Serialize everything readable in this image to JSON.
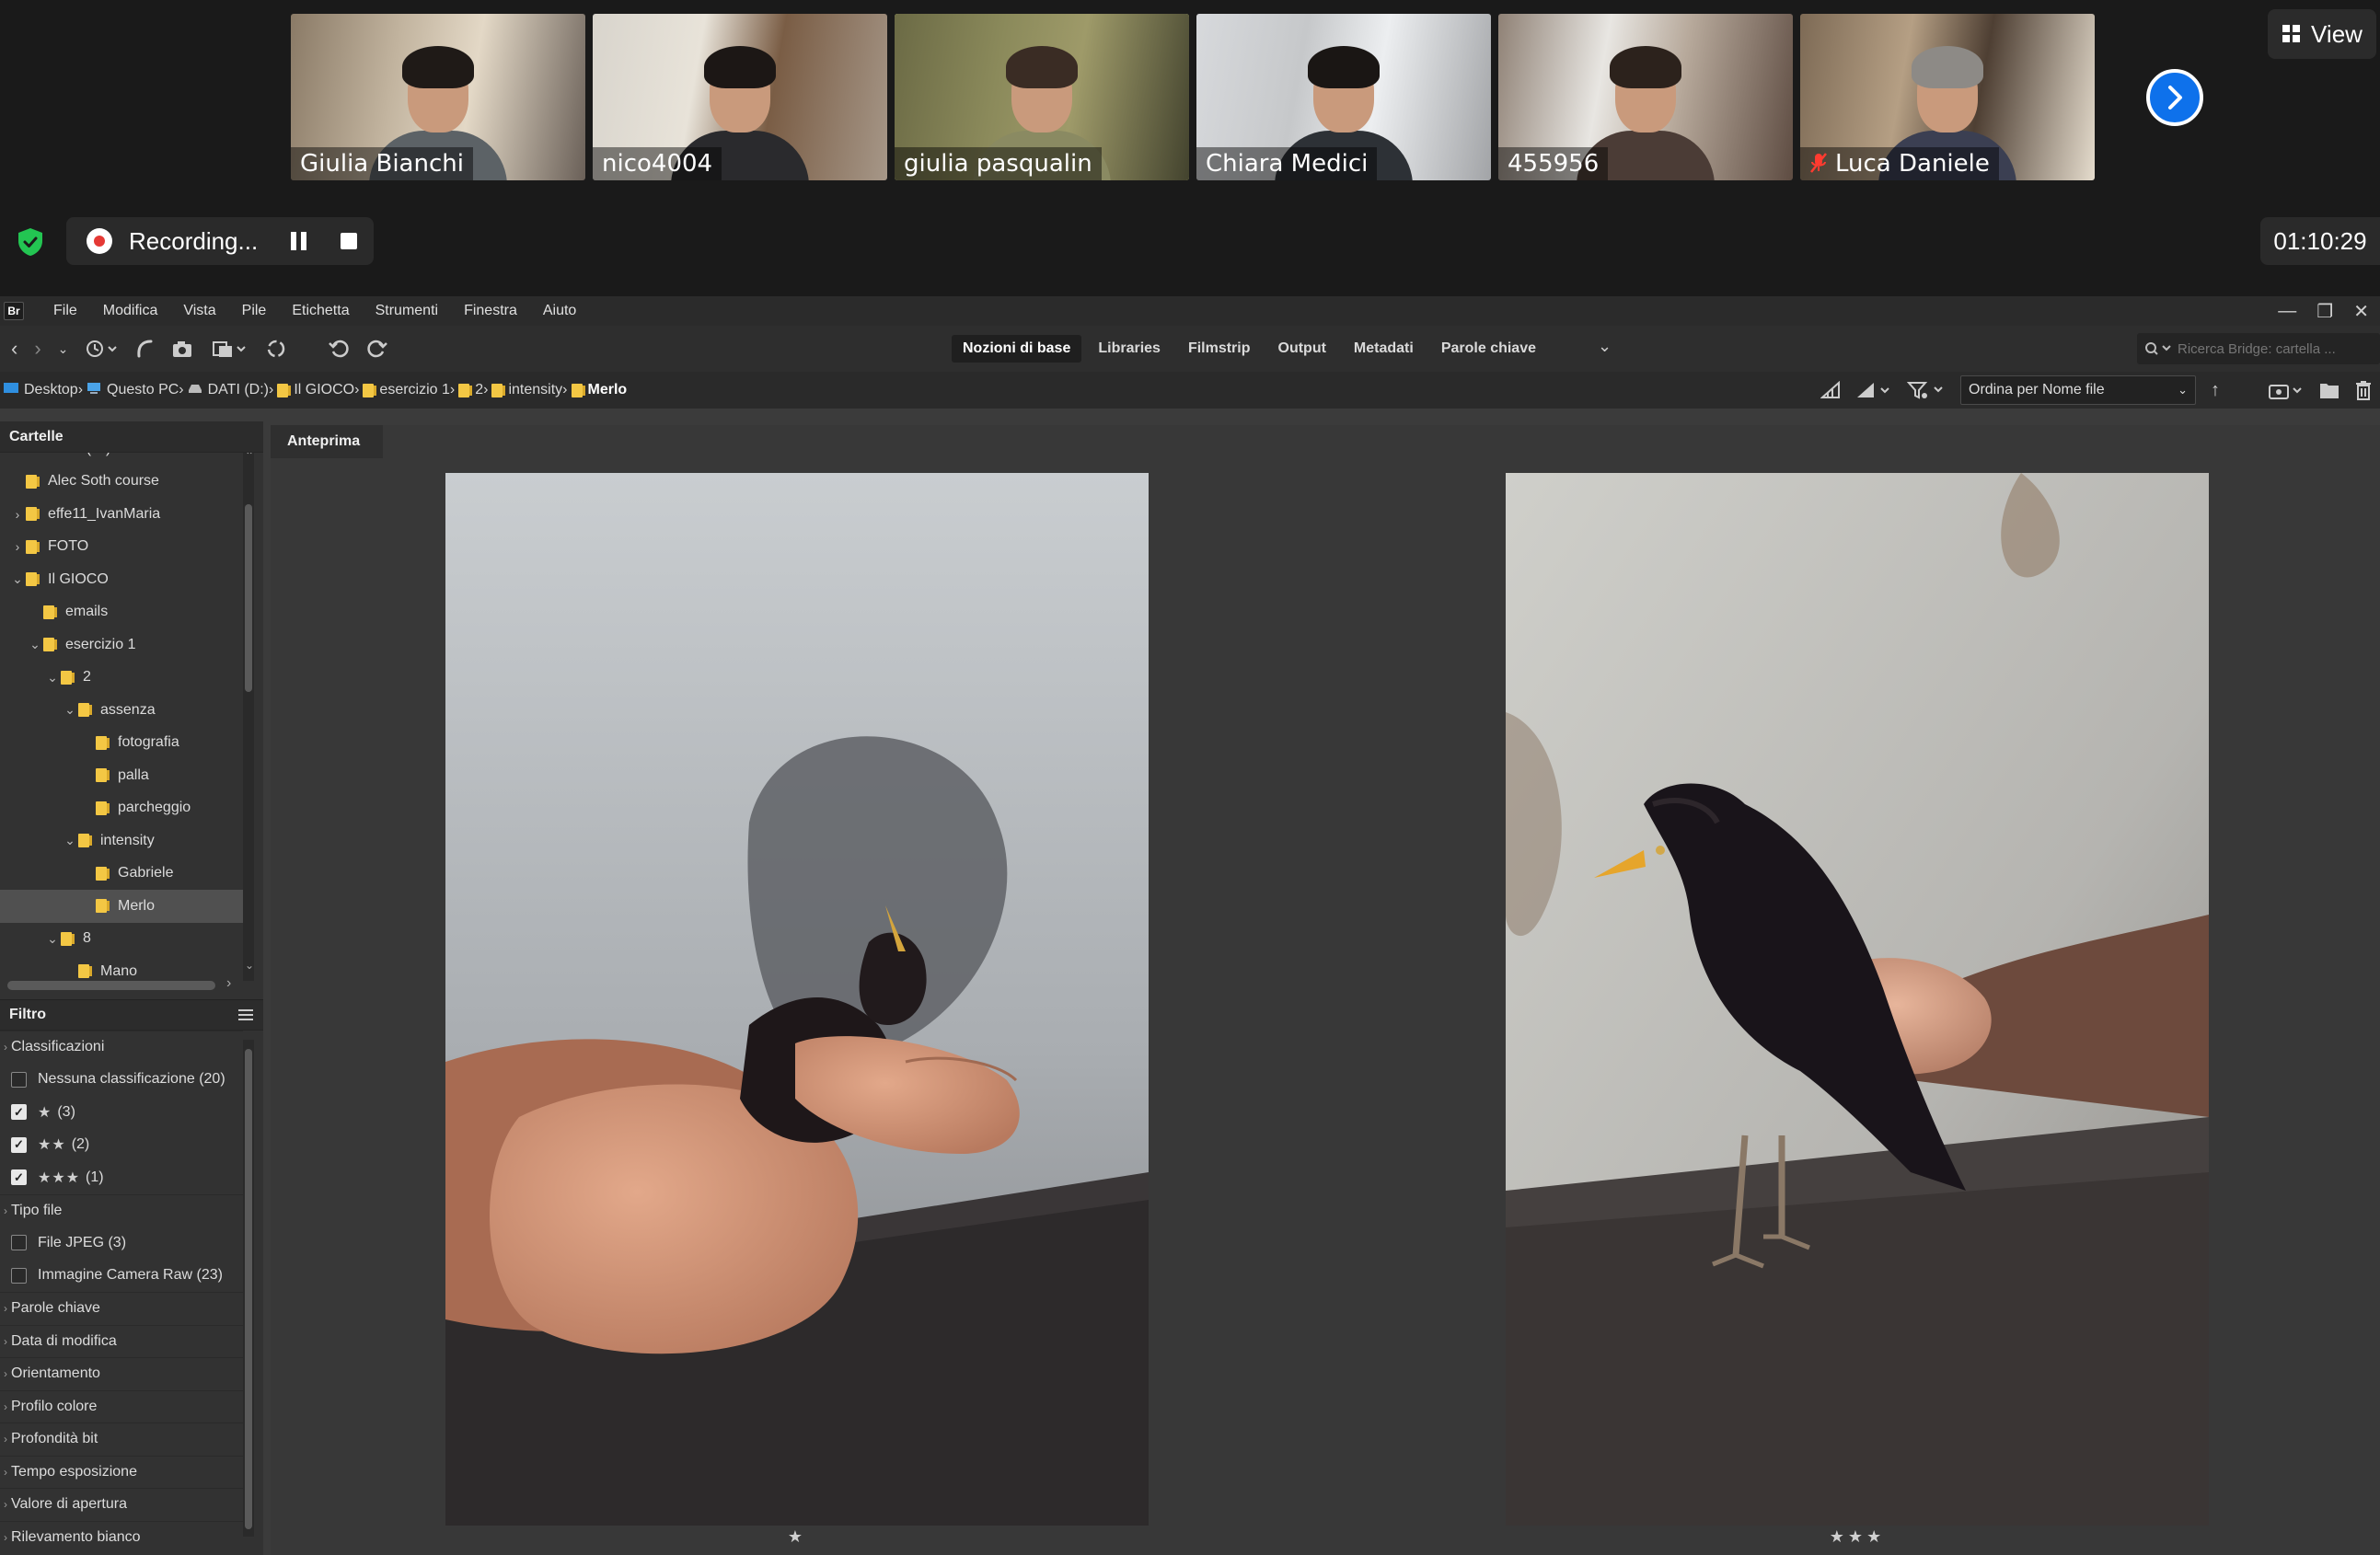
{
  "zoom": {
    "participants": [
      {
        "name": "Giulia Bianchi",
        "active": false,
        "muted": false
      },
      {
        "name": "nico4004",
        "active": false,
        "muted": false
      },
      {
        "name": "giulia pasqualin",
        "active": true,
        "muted": false
      },
      {
        "name": "Chiara Medici",
        "active": false,
        "muted": false
      },
      {
        "name": "455956",
        "active": false,
        "muted": false
      },
      {
        "name": "Luca Daniele",
        "active": false,
        "muted": true
      }
    ],
    "view_label": "View",
    "recording_label": "Recording...",
    "timer": "01:10:29"
  },
  "bridge": {
    "logo": "Br",
    "menu": [
      "File",
      "Modifica",
      "Vista",
      "Pile",
      "Etichetta",
      "Strumenti",
      "Finestra",
      "Aiuto"
    ],
    "workspaces": [
      "Nozioni di base",
      "Libraries",
      "Filmstrip",
      "Output",
      "Metadati",
      "Parole chiave"
    ],
    "active_workspace": "Nozioni di base",
    "search_placeholder": "Ricerca Bridge: cartella ...",
    "breadcrumb": [
      "Desktop",
      "Questo PC",
      "DATI (D:)",
      "Il GIOCO",
      "esercizio 1",
      "2",
      "intensity",
      "Merlo"
    ],
    "sort_label": "Ordina per Nome file",
    "folders_title": "Cartelle",
    "folder_tree": [
      {
        "label": "DATI (D:)",
        "depth": 1,
        "chevron": "",
        "folder": false
      },
      {
        "label": "Alec Soth course",
        "depth": 1,
        "chevron": "",
        "folder": true
      },
      {
        "label": "effe11_IvanMaria",
        "depth": 1,
        "chevron": "›",
        "folder": true
      },
      {
        "label": "FOTO",
        "depth": 1,
        "chevron": "›",
        "folder": true
      },
      {
        "label": "Il GIOCO",
        "depth": 1,
        "chevron": "⌄",
        "folder": true
      },
      {
        "label": "emails",
        "depth": 2,
        "chevron": "",
        "folder": true
      },
      {
        "label": "esercizio 1",
        "depth": 2,
        "chevron": "⌄",
        "folder": true
      },
      {
        "label": "2",
        "depth": 3,
        "chevron": "⌄",
        "folder": true
      },
      {
        "label": "assenza",
        "depth": 4,
        "chevron": "⌄",
        "folder": true
      },
      {
        "label": "fotografia",
        "depth": 5,
        "chevron": "",
        "folder": true
      },
      {
        "label": "palla",
        "depth": 5,
        "chevron": "",
        "folder": true
      },
      {
        "label": "parcheggio",
        "depth": 5,
        "chevron": "",
        "folder": true
      },
      {
        "label": "intensity",
        "depth": 4,
        "chevron": "⌄",
        "folder": true
      },
      {
        "label": "Gabriele",
        "depth": 5,
        "chevron": "",
        "folder": true
      },
      {
        "label": "Merlo",
        "depth": 5,
        "chevron": "",
        "folder": true,
        "selected": true
      },
      {
        "label": "8",
        "depth": 3,
        "chevron": "⌄",
        "folder": true
      },
      {
        "label": "Mano",
        "depth": 4,
        "chevron": "",
        "folder": true
      }
    ],
    "filter_title": "Filtro",
    "filter": [
      {
        "type": "section",
        "label": "Classificazioni"
      },
      {
        "type": "option",
        "label": "Nessuna classificazione (20)",
        "checked": false,
        "stars": ""
      },
      {
        "type": "option",
        "label": "(3)",
        "checked": true,
        "stars": "★"
      },
      {
        "type": "option",
        "label": "(2)",
        "checked": true,
        "stars": "★★"
      },
      {
        "type": "option",
        "label": "(1)",
        "checked": true,
        "stars": "★★★"
      },
      {
        "type": "section",
        "label": "Tipo file"
      },
      {
        "type": "option",
        "label": "File JPEG (3)",
        "checked": false,
        "stars": ""
      },
      {
        "type": "option",
        "label": "Immagine Camera Raw (23)",
        "checked": false,
        "stars": ""
      },
      {
        "type": "section",
        "label": "Parole chiave"
      },
      {
        "type": "section",
        "label": "Data di modifica"
      },
      {
        "type": "section",
        "label": "Orientamento"
      },
      {
        "type": "section",
        "label": "Profilo colore"
      },
      {
        "type": "section",
        "label": "Profondità bit"
      },
      {
        "type": "section",
        "label": "Tempo esposizione"
      },
      {
        "type": "section",
        "label": "Valore di apertura"
      },
      {
        "type": "section",
        "label": "Rilevamento bianco"
      }
    ],
    "preview_tab": "Anteprima",
    "previews": [
      {
        "alt": "Blackbird held in two hands",
        "rating": 1
      },
      {
        "alt": "Blackbird perched on a hand",
        "rating": 3
      }
    ]
  }
}
